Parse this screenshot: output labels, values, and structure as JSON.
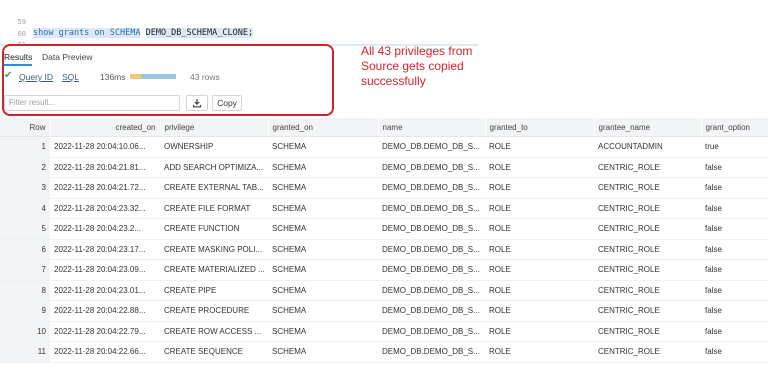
{
  "editor": {
    "line_numbers": [
      "59",
      "60",
      "61"
    ],
    "statement_keywords": "show grants on SCHEMA",
    "statement_object": "DEMO_DB_SCHEMA_CLONE;"
  },
  "results": {
    "tabs": [
      "Results",
      "Data Preview"
    ],
    "query_id_label": "Query ID",
    "sql_label": "SQL",
    "duration": "136ms",
    "row_count": "43 rows",
    "filter_placeholder": "Filter result...",
    "copy_label": "Copy"
  },
  "annotation": "All 43 privileges from Source gets copied successfully",
  "colors": {
    "annotation": "#d2232a",
    "success": "#34a853",
    "tab_underline": "#2a8fd6"
  },
  "table": {
    "headers": [
      "Row",
      "created_on",
      "privilege",
      "granted_on",
      "name",
      "granted_to",
      "grantee_name",
      "grant_option"
    ],
    "rows": [
      [
        "1",
        "2022-11-28 20:04:10.06...",
        "OWNERSHIP",
        "SCHEMA",
        "DEMO_DB.DEMO_DB_S...",
        "ROLE",
        "ACCOUNTADMIN",
        "true"
      ],
      [
        "2",
        "2022-11-28 20:04:21.81...",
        "ADD SEARCH OPTIMIZA...",
        "SCHEMA",
        "DEMO_DB.DEMO_DB_S...",
        "ROLE",
        "CENTRIC_ROLE",
        "false"
      ],
      [
        "3",
        "2022-11-28 20:04:21.72...",
        "CREATE EXTERNAL TAB...",
        "SCHEMA",
        "DEMO_DB.DEMO_DB_S...",
        "ROLE",
        "CENTRIC_ROLE",
        "false"
      ],
      [
        "4",
        "2022-11-28 20:04:23.32...",
        "CREATE FILE FORMAT",
        "SCHEMA",
        "DEMO_DB.DEMO_DB_S...",
        "ROLE",
        "CENTRIC_ROLE",
        "false"
      ],
      [
        "5",
        "2022-11-28 20:04:23.2...",
        "CREATE FUNCTION",
        "SCHEMA",
        "DEMO_DB.DEMO_DB_S...",
        "ROLE",
        "CENTRIC_ROLE",
        "false"
      ],
      [
        "6",
        "2022-11-28 20:04:23.17...",
        "CREATE MASKING POLI...",
        "SCHEMA",
        "DEMO_DB.DEMO_DB_S...",
        "ROLE",
        "CENTRIC_ROLE",
        "false"
      ],
      [
        "7",
        "2022-11-28 20:04:23.09...",
        "CREATE MATERIALIZED ...",
        "SCHEMA",
        "DEMO_DB.DEMO_DB_S...",
        "ROLE",
        "CENTRIC_ROLE",
        "false"
      ],
      [
        "8",
        "2022-11-28 20:04:23.01...",
        "CREATE PIPE",
        "SCHEMA",
        "DEMO_DB.DEMO_DB_S...",
        "ROLE",
        "CENTRIC_ROLE",
        "false"
      ],
      [
        "9",
        "2022-11-28 20:04:22.88...",
        "CREATE PROCEDURE",
        "SCHEMA",
        "DEMO_DB.DEMO_DB_S...",
        "ROLE",
        "CENTRIC_ROLE",
        "false"
      ],
      [
        "10",
        "2022-11-28 20:04:22.79...",
        "CREATE ROW ACCESS ...",
        "SCHEMA",
        "DEMO_DB.DEMO_DB_S...",
        "ROLE",
        "CENTRIC_ROLE",
        "false"
      ],
      [
        "11",
        "2022-11-28 20:04:22.66...",
        "CREATE SEQUENCE",
        "SCHEMA",
        "DEMO_DB.DEMO_DB_S...",
        "ROLE",
        "CENTRIC_ROLE",
        "false"
      ]
    ]
  }
}
